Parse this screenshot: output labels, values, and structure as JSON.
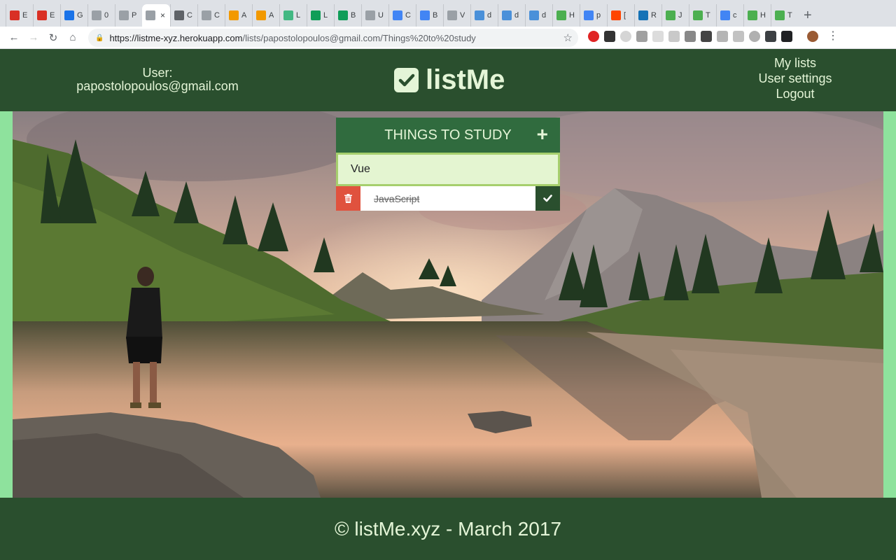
{
  "browser": {
    "tabs": [
      {
        "label": "E",
        "icon": "gmail-icon",
        "color": "#d93025"
      },
      {
        "label": "E",
        "icon": "gmail-icon",
        "color": "#d93025"
      },
      {
        "label": "G",
        "icon": "calendar-icon",
        "color": "#1a73e8"
      },
      {
        "label": "0",
        "icon": "document-icon",
        "color": "#9aa0a6"
      },
      {
        "label": "P",
        "icon": "document-icon",
        "color": "#9aa0a6"
      },
      {
        "label": "",
        "icon": "document-icon",
        "color": "#9aa0a6",
        "active": true
      },
      {
        "label": "C",
        "icon": "globe-icon",
        "color": "#5f6368"
      },
      {
        "label": "C",
        "icon": "document-icon",
        "color": "#9aa0a6"
      },
      {
        "label": "A",
        "icon": "asterisk-icon",
        "color": "#f29900"
      },
      {
        "label": "A",
        "icon": "asterisk-icon",
        "color": "#f29900"
      },
      {
        "label": "L",
        "icon": "vue-icon",
        "color": "#42b883"
      },
      {
        "label": "L",
        "icon": "sheets-icon",
        "color": "#0f9d58"
      },
      {
        "label": "B",
        "icon": "sheets-icon",
        "color": "#0f9d58"
      },
      {
        "label": "U",
        "icon": "document-icon",
        "color": "#9aa0a6"
      },
      {
        "label": "C",
        "icon": "shield-icon",
        "color": "#4285f4"
      },
      {
        "label": "B",
        "icon": "shield-icon",
        "color": "#4285f4"
      },
      {
        "label": "V",
        "icon": "document-icon",
        "color": "#9aa0a6"
      },
      {
        "label": "d",
        "icon": "bird-icon",
        "color": "#4a90d9"
      },
      {
        "label": "d",
        "icon": "bird-icon",
        "color": "#4a90d9"
      },
      {
        "label": "d",
        "icon": "bird-icon",
        "color": "#4a90d9"
      },
      {
        "label": "H",
        "icon": "w3-icon",
        "color": "#4caf50"
      },
      {
        "label": "p",
        "icon": "google-icon",
        "color": "#4285f4"
      },
      {
        "label": "[",
        "icon": "reddit-icon",
        "color": "#ff4500"
      },
      {
        "label": "R",
        "icon": "css3-icon",
        "color": "#1572b6"
      },
      {
        "label": "J",
        "icon": "w3-icon",
        "color": "#4caf50"
      },
      {
        "label": "T",
        "icon": "w3-icon",
        "color": "#4caf50"
      },
      {
        "label": "c",
        "icon": "google-icon",
        "color": "#4285f4"
      },
      {
        "label": "H",
        "icon": "w3-icon",
        "color": "#4caf50"
      },
      {
        "label": "T",
        "icon": "w3-icon",
        "color": "#4caf50"
      }
    ],
    "url_host": "https://listme-xyz.herokuapp.com",
    "url_path": "/lists/papostolopoulos@gmail.com/Things%20to%20study"
  },
  "header": {
    "user_label": "User:",
    "user_email": "papostolopoulos@gmail.com",
    "brand": "listMe",
    "nav": [
      "My lists",
      "User settings",
      "Logout"
    ]
  },
  "list": {
    "title": "THINGS TO STUDY",
    "input_value": "Vue",
    "items": [
      {
        "text": "JavaScript",
        "completed": true
      }
    ]
  },
  "footer": {
    "text": "© listMe.xyz - March 2017"
  },
  "colors": {
    "header_bg": "#2a4f2e",
    "accent_green": "#306b3e",
    "light_text": "#e4f5d7",
    "input_bg": "#e4f5d1",
    "input_border": "#a6cf6d",
    "delete_red": "#e0523e",
    "side_strip": "#8ee29d"
  }
}
